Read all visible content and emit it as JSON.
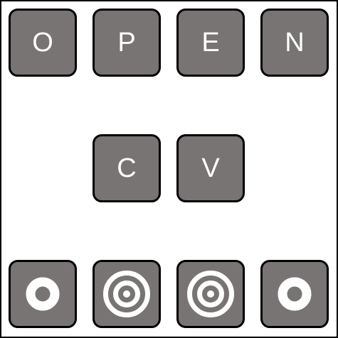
{
  "keys": {
    "row1": [
      "O",
      "P",
      "E",
      "N"
    ],
    "row2": [
      "C",
      "V"
    ]
  },
  "buttons": [
    {
      "icon": "ring-icon"
    },
    {
      "icon": "target-icon"
    },
    {
      "icon": "target-icon"
    },
    {
      "icon": "ring-icon"
    }
  ],
  "colors": {
    "tile": "#787473",
    "tile_border": "#000000",
    "glyph": "#ffffff",
    "background": "#ffffff"
  }
}
